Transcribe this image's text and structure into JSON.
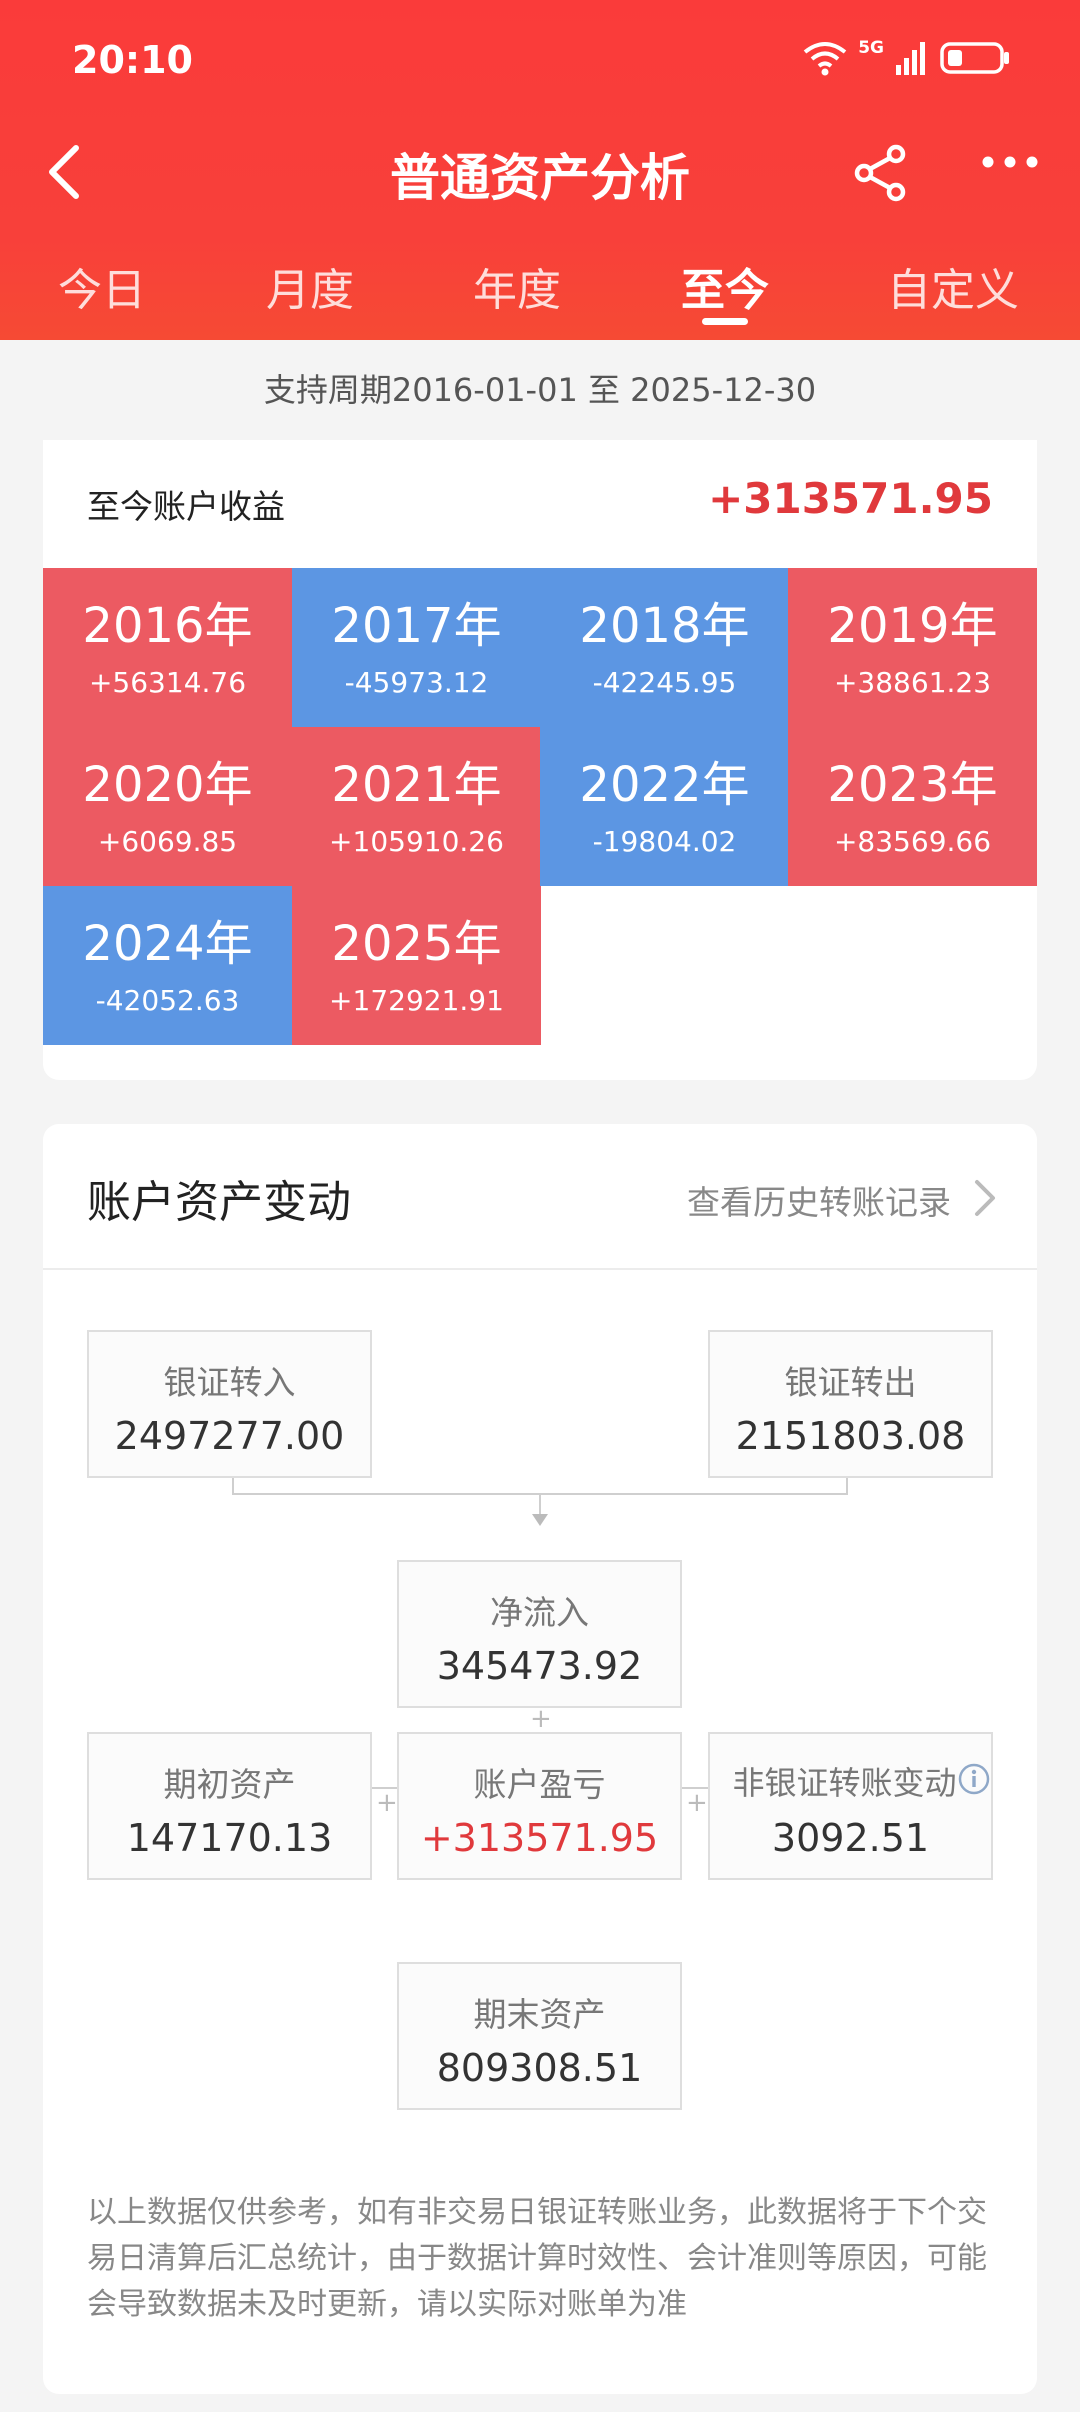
{
  "status_bar": {
    "time": "20:10",
    "network": "5G"
  },
  "header": {
    "title": "普通资产分析"
  },
  "tabs": [
    {
      "label": "今日",
      "active": false
    },
    {
      "label": "月度",
      "active": false
    },
    {
      "label": "年度",
      "active": false
    },
    {
      "label": "至今",
      "active": true
    },
    {
      "label": "自定义",
      "active": false
    }
  ],
  "period": "支持周期2016-01-01 至 2025-12-30",
  "income_card": {
    "label": "至今账户收益",
    "total": "+313571.95",
    "years": [
      {
        "year": "2016年",
        "value": "+56314.76",
        "color": "#ec5a62"
      },
      {
        "year": "2017年",
        "value": "-45973.12",
        "color": "#5c96e3"
      },
      {
        "year": "2018年",
        "value": "-42245.95",
        "color": "#5c96e3"
      },
      {
        "year": "2019年",
        "value": "+38861.23",
        "color": "#ec5a62"
      },
      {
        "year": "2020年",
        "value": "+6069.85",
        "color": "#ec5a62"
      },
      {
        "year": "2021年",
        "value": "+105910.26",
        "color": "#ec5a62"
      },
      {
        "year": "2022年",
        "value": "-19804.02",
        "color": "#5c96e3"
      },
      {
        "year": "2023年",
        "value": "+83569.66",
        "color": "#ec5a62"
      },
      {
        "year": "2024年",
        "value": "-42052.63",
        "color": "#5c96e3"
      },
      {
        "year": "2025年",
        "value": "+172921.91",
        "color": "#ec5a62"
      }
    ]
  },
  "asset_card": {
    "title": "账户资产变动",
    "link": "查看历史转账记录",
    "bank_in": {
      "label": "银证转入",
      "value": "2497277.00"
    },
    "bank_out": {
      "label": "银证转出",
      "value": "2151803.08"
    },
    "net_inflow": {
      "label": "净流入",
      "value": "345473.92"
    },
    "initial": {
      "label": "期初资产",
      "value": "147170.13"
    },
    "pnl": {
      "label": "账户盈亏",
      "value": "+313571.95"
    },
    "non_bank": {
      "label": "非银证转账变动",
      "value": "3092.51"
    },
    "final": {
      "label": "期末资产",
      "value": "809308.51"
    },
    "note": "以上数据仅供参考，如有非交易日银证转账业务，此数据将于下个交易日清算后汇总统计，由于数据计算时效性、会计准则等原因，可能会导致数据未及时更新，请以实际对账单为准"
  }
}
